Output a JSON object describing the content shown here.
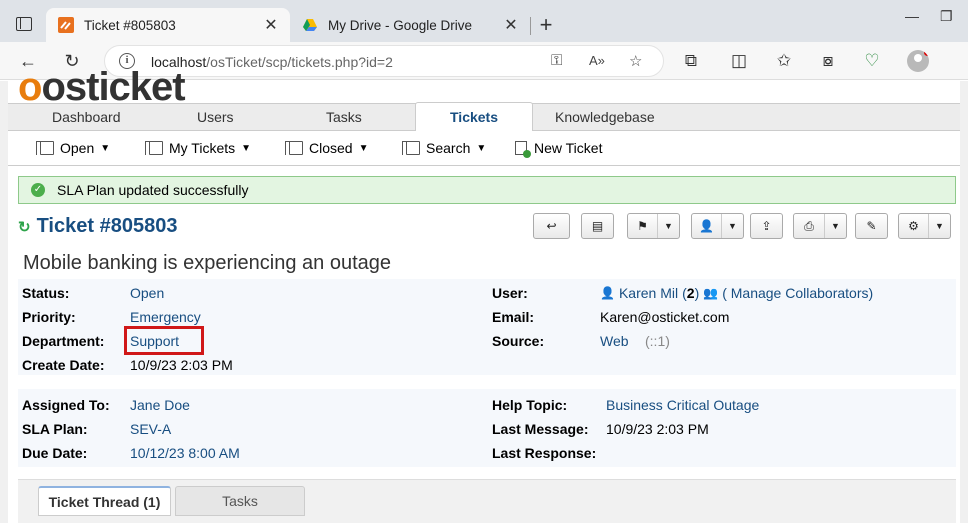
{
  "browser": {
    "tabs": [
      {
        "title": "Ticket #805803",
        "close": "✕"
      },
      {
        "title": "My Drive - Google Drive",
        "close": "✕"
      }
    ],
    "new_tab": "+",
    "address": {
      "host": "localhost",
      "path": "/osTicket/scp/tickets.php?id=2"
    }
  },
  "app": {
    "logo": {
      "o": "o",
      "rest": "osticket"
    },
    "main_nav": [
      "Dashboard",
      "Users",
      "Tasks",
      "Tickets",
      "Knowledgebase"
    ],
    "active_nav": "Tickets",
    "sub_nav": [
      {
        "label": "Open",
        "caret": true
      },
      {
        "label": "My Tickets",
        "caret": true
      },
      {
        "label": "Closed",
        "caret": true
      },
      {
        "label": "Search",
        "caret": true
      },
      {
        "label": "New Ticket",
        "caret": false
      }
    ]
  },
  "alert": {
    "message": "SLA Plan updated successfully"
  },
  "ticket": {
    "number": "Ticket #805803",
    "subject": "Mobile banking is experiencing an outage",
    "left1": [
      {
        "label": "Status:",
        "value": "Open"
      },
      {
        "label": "Priority:",
        "value": "Emergency"
      },
      {
        "label": "Department:",
        "value": "Support"
      },
      {
        "label": "Create Date:",
        "value": "10/9/23 2:03 PM"
      }
    ],
    "right1": {
      "user_label": "User:",
      "user_name": "Karen Mil",
      "user_count_open": "(",
      "user_count": "2",
      "user_count_close": ")",
      "collab": "( Manage Collaborators)",
      "email_label": "Email:",
      "email": "Karen@osticket.com",
      "source_label": "Source:",
      "source": "Web",
      "source_ip": "(::1)"
    },
    "left2": [
      {
        "label": "Assigned To:",
        "value": "Jane Doe"
      },
      {
        "label": "SLA Plan:",
        "value": "SEV-A"
      },
      {
        "label": "Due Date:",
        "value": "10/12/23 8:00 AM"
      }
    ],
    "right2": [
      {
        "label": "Help Topic:",
        "value": "Business Critical Outage"
      },
      {
        "label": "Last Message:",
        "value": "10/9/23 2:03 PM"
      },
      {
        "label": "Last Response:",
        "value": ""
      }
    ]
  },
  "thread_tabs": [
    "Ticket Thread (1)",
    "Tasks"
  ],
  "colors": {
    "link": "#184e81",
    "highlight": "#d01818",
    "success_bg": "#e3f5e1"
  }
}
